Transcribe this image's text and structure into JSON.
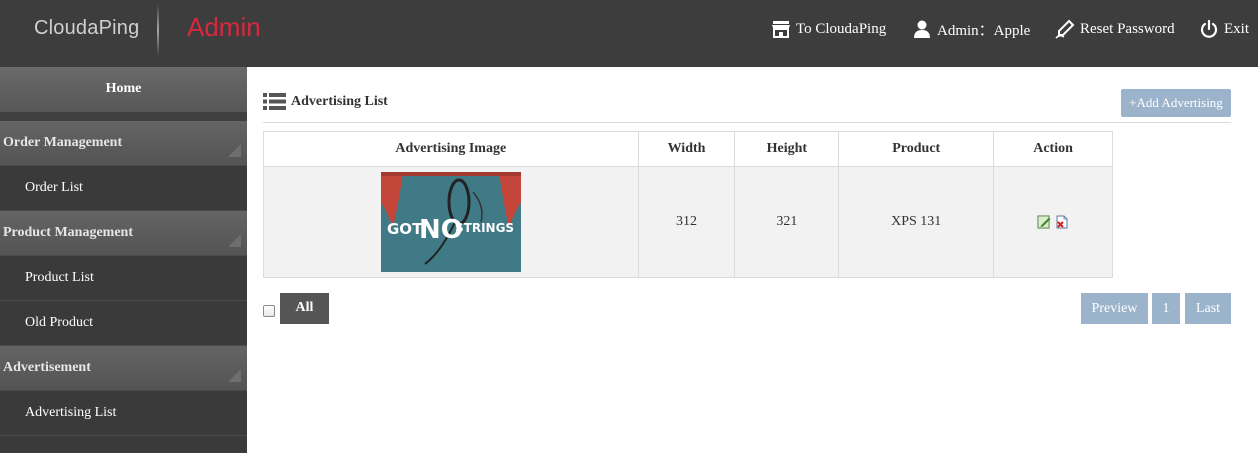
{
  "header": {
    "brand": "CloudaPing",
    "title": "Admin",
    "nav": [
      {
        "icon": "store-icon",
        "label": "To CloudaPing"
      },
      {
        "icon": "user-icon",
        "label": "Admin：Apple"
      },
      {
        "icon": "pen-icon",
        "label": "Reset Password"
      },
      {
        "icon": "power-icon",
        "label": "Exit"
      }
    ]
  },
  "sidebar": {
    "home": "Home",
    "sections": [
      {
        "label": "Order Management",
        "items": [
          "Order List"
        ]
      },
      {
        "label": "Product Management",
        "items": [
          "Product List",
          "Old Product"
        ]
      },
      {
        "label": "Advertisement",
        "items": [
          "Advertising List"
        ]
      }
    ]
  },
  "main": {
    "title": "Advertising List",
    "add_button": "+Add Advertising",
    "table": {
      "columns": [
        "Advertising Image",
        "Width",
        "Height",
        "Product",
        "Action"
      ],
      "rows": [
        {
          "image_text_1": "GOT",
          "image_text_2": "NO",
          "image_text_3": "STRINGS",
          "width": "312",
          "height": "321",
          "product": "XPS 131"
        }
      ]
    },
    "select_all_label": "All",
    "pagination": {
      "prev": "Preview",
      "page": "1",
      "last": "Last"
    }
  },
  "colors": {
    "topbar": "#3d3d3d",
    "admin_accent": "#d9283e",
    "button_blue": "#9cb3cc",
    "sidebar_dark": "#3a3a3a"
  }
}
